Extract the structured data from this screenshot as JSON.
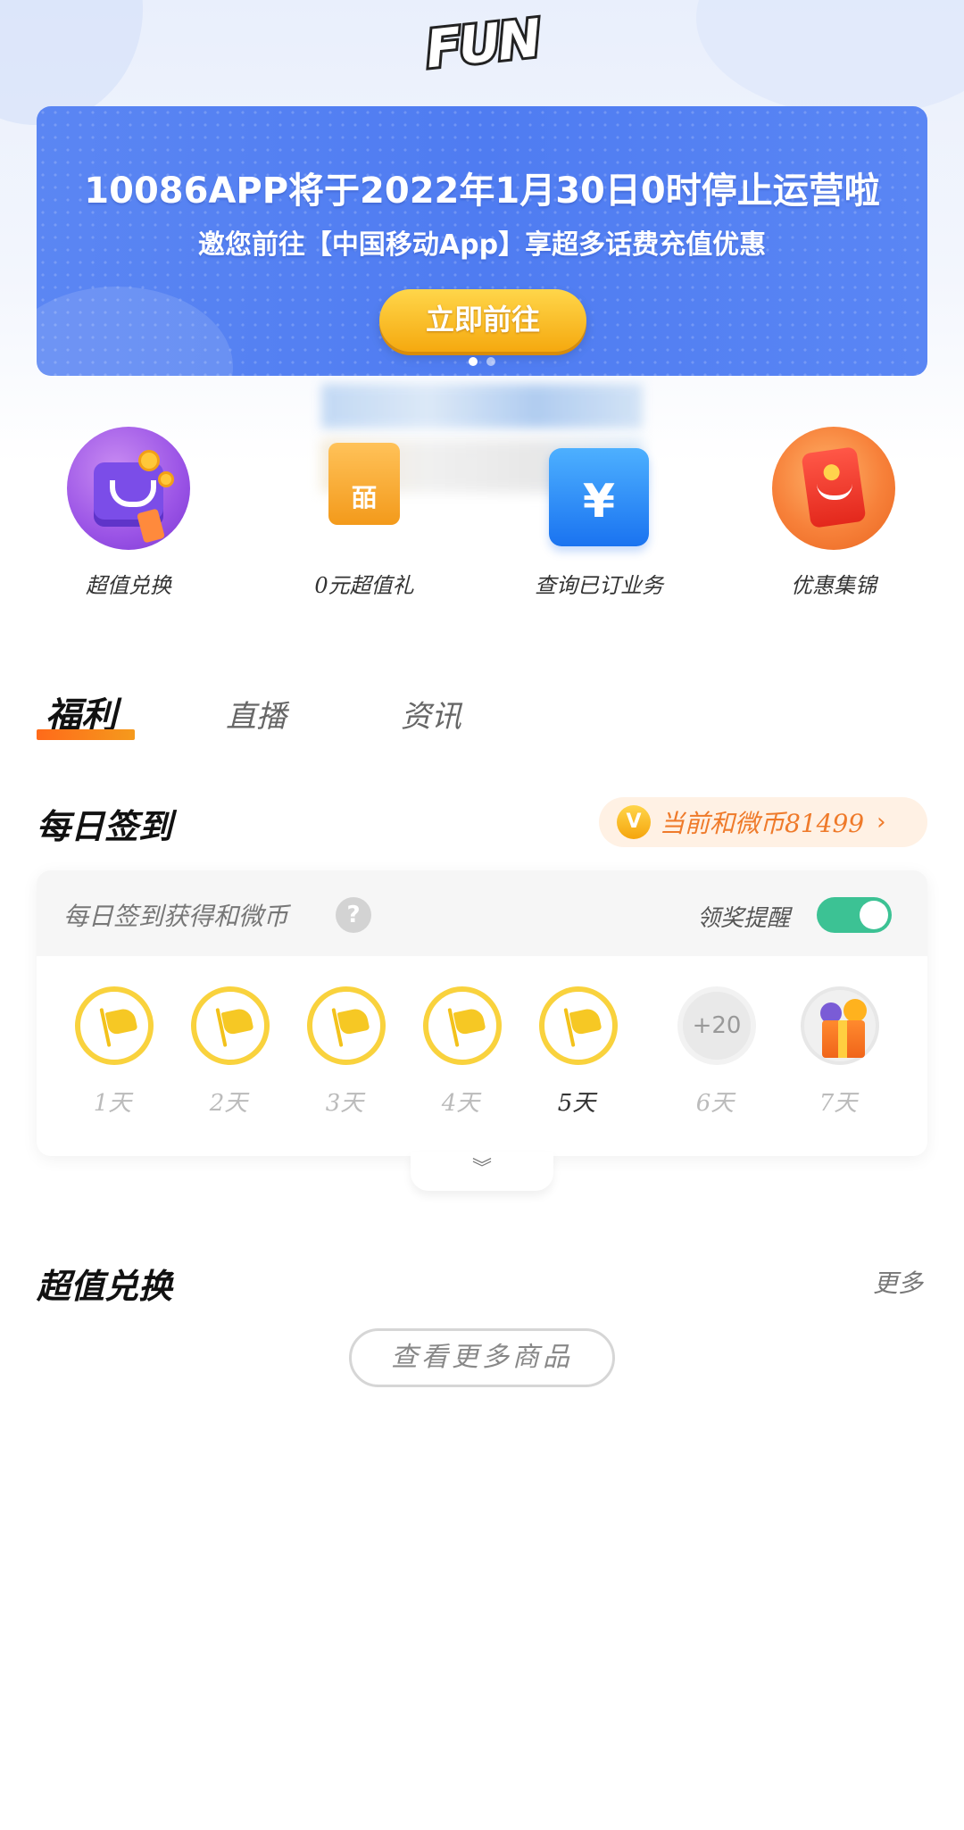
{
  "header": {
    "logo_text": "FUN"
  },
  "banner": {
    "title": "10086APP将于2022年1月30日0时停止运营啦",
    "subtitle": "邀您前往【中国移动App】享超多话费充值优惠",
    "button_label": "立即前往",
    "page_count": 2,
    "active_page": 1
  },
  "quick_actions": [
    {
      "label": "超值兑换",
      "icon": "shopping-bag-icon"
    },
    {
      "label": "0元超值礼",
      "icon": "gift-card-icon",
      "icon_text": "皕"
    },
    {
      "label": "查询已订业务",
      "icon": "yuan-icon",
      "icon_text": "¥"
    },
    {
      "label": "优惠集锦",
      "icon": "red-envelope-icon"
    }
  ],
  "tabs": [
    {
      "label": "福利",
      "active": true
    },
    {
      "label": "直播",
      "active": false
    },
    {
      "label": "资讯",
      "active": false
    }
  ],
  "daily_checkin": {
    "title": "每日签到",
    "coin_balance_text": "当前和微币81499",
    "coin_badge": "V",
    "chevron": "›",
    "description": "每日签到获得和微币",
    "help_mark": "?",
    "reminder_label": "领奖提醒",
    "reminder_on": true,
    "days": [
      {
        "label": "1天",
        "state": "done"
      },
      {
        "label": "2天",
        "state": "done"
      },
      {
        "label": "3天",
        "state": "done"
      },
      {
        "label": "4天",
        "state": "done"
      },
      {
        "label": "5天",
        "state": "done",
        "today": true
      },
      {
        "label": "6天",
        "state": "pending",
        "reward": "+20"
      },
      {
        "label": "7天",
        "state": "gift"
      }
    ],
    "expand_icon": "︾"
  },
  "exchange": {
    "title": "超值兑换",
    "more_label": "更多",
    "more_goods_label": "查看更多商品"
  },
  "colors": {
    "banner_blue": "#4f7cf1",
    "accent_orange": "#ef7a2a",
    "toggle_green": "#3cc294",
    "checkin_yellow": "#f9d23d"
  }
}
